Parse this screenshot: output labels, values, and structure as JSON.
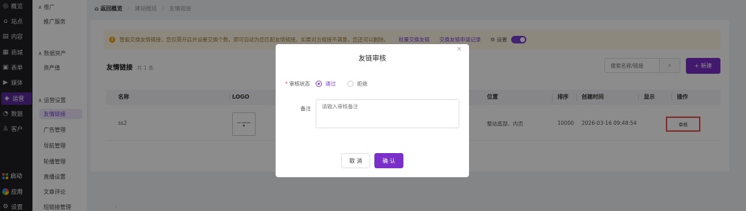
{
  "nav": {
    "items": [
      {
        "icon": "eye-icon",
        "glyph": "◎",
        "label": "概览"
      },
      {
        "icon": "home-icon",
        "glyph": "⌂",
        "label": "站点"
      },
      {
        "icon": "document-icon",
        "glyph": "▤",
        "label": "内容"
      },
      {
        "icon": "shop-icon",
        "glyph": "▦",
        "label": "商城"
      },
      {
        "icon": "form-icon",
        "glyph": "▣",
        "label": "表单"
      },
      {
        "icon": "media-icon",
        "glyph": "▶",
        "label": "媒体"
      },
      {
        "icon": "operation-icon",
        "glyph": "◈",
        "label": "运营",
        "active": true
      },
      {
        "icon": "data-icon",
        "glyph": "◔",
        "label": "数据"
      },
      {
        "icon": "customer-icon",
        "glyph": "♙",
        "label": "客户"
      },
      {
        "icon": "launch-icon",
        "glyph": "",
        "label": "启动"
      },
      {
        "icon": "apps-icon",
        "glyph": "",
        "label": "应用"
      },
      {
        "icon": "settings-icon",
        "glyph": "⚙",
        "label": "设置"
      }
    ]
  },
  "subnav": {
    "groups": [
      {
        "label": "∧ 推广",
        "items": [
          "推广服务"
        ]
      },
      {
        "label": "∧ 数据资产",
        "items": [
          "资产值"
        ]
      },
      {
        "label": "∧ 运营设置",
        "items": [
          "友情链接",
          "广告管理",
          "导航管理",
          "轮播管理",
          "直播设置",
          "文章评论",
          "短链接管理"
        ]
      }
    ],
    "active": "友情链接"
  },
  "breadcrumb": {
    "home": "返回概览",
    "level1": "建站概括",
    "level2": "友情链接"
  },
  "notice": {
    "text": "智能交换友情链接，您仅需开启并设置交换个数，即可自动为您匹配友情链接。如果对方链接不满意，您还可以删除。",
    "batch_link": "批量交换友链",
    "record_link": "交换友链申请记录",
    "settings_label": "设置",
    "toggle_on": true
  },
  "list": {
    "title": "友情链接",
    "count": "共 1 条",
    "search_placeholder": "搜索名称/链接",
    "new_button": "+ 新建"
  },
  "table": {
    "columns": [
      "名称",
      "LOGO",
      "位置",
      "排序",
      "创建时间",
      "显示",
      "操作"
    ],
    "rows": [
      {
        "name": "ss2",
        "logo_text": "ss tulokset",
        "position": "整站底部、内页",
        "sort": "10000",
        "created": "2026-03-16 09:48:54",
        "action": "审核"
      }
    ]
  },
  "modal": {
    "title": "友链审核",
    "status_label": "审核状态",
    "options": [
      "通过",
      "拒绝"
    ],
    "selected": "通过",
    "remark_label": "备注",
    "remark_placeholder": "请输入审核备注",
    "cancel": "取 消",
    "confirm": "确 认"
  }
}
